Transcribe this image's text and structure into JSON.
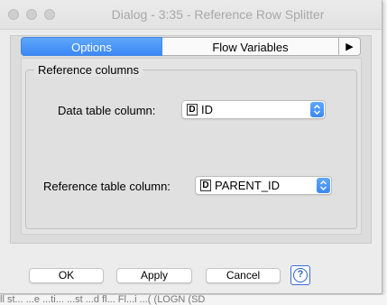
{
  "window": {
    "title": "Dialog - 3:35 - Reference Row Splitter"
  },
  "tabs": [
    {
      "label": "Options",
      "active": true
    },
    {
      "label": "Flow Variables",
      "active": false
    },
    {
      "label": "▶",
      "active": false
    }
  ],
  "reference_columns": {
    "title": "Reference columns",
    "data_table_column": {
      "label": "Data table column:",
      "type_badge": "D",
      "value": "ID"
    },
    "reference_table_column": {
      "label": "Reference table column:",
      "type_badge": "D",
      "value": "PARENT_ID"
    }
  },
  "buttons": {
    "ok": "OK",
    "apply": "Apply",
    "cancel": "Cancel",
    "help": "?"
  },
  "background_status_text": "ll st... ...e  ...ti...  ...st  ...d fl... Fl...i ...( (LOGN (SD",
  "colors": {
    "accent": "#3b88f5",
    "window_bg": "#ececec",
    "help_blue": "#2f62c9"
  }
}
